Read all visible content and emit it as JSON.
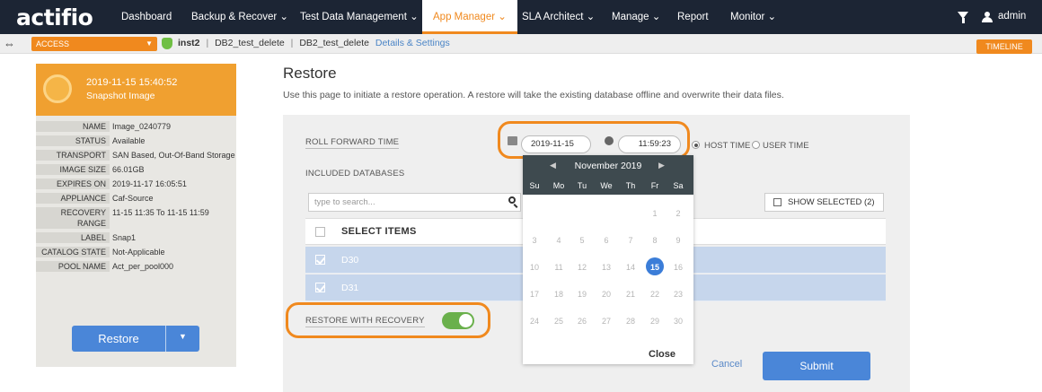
{
  "brand": {
    "logo": "actifio",
    "accent": "#f0891e",
    "nav_bg": "#1c2534"
  },
  "topnav": {
    "items": [
      {
        "label": "Dashboard"
      },
      {
        "label": "Backup & Recover ⌄"
      },
      {
        "label": "Test Data Management ⌄"
      },
      {
        "label": "App Manager ⌄",
        "active": true
      },
      {
        "label": "SLA Architect ⌄"
      },
      {
        "label": "Manage ⌄"
      },
      {
        "label": "Report"
      },
      {
        "label": "Monitor ⌄"
      }
    ],
    "user": "admin",
    "filter_icon": "filter-icon",
    "user_icon": "user-icon"
  },
  "subbar": {
    "access": "ACCESS",
    "instance": "inst2",
    "db1": "DB2_test_delete",
    "db2": "DB2_test_delete",
    "details": "Details & Settings",
    "timeline": "TIMELINE"
  },
  "snapshot": {
    "date": "2019-11-15 15:40:52",
    "type": "Snapshot Image",
    "props": [
      {
        "k": "NAME",
        "v": "Image_0240779"
      },
      {
        "k": "STATUS",
        "v": "Available"
      },
      {
        "k": "TRANSPORT",
        "v": "SAN Based, Out-Of-Band Storage"
      },
      {
        "k": "IMAGE SIZE",
        "v": "66.01GB"
      },
      {
        "k": "EXPIRES ON",
        "v": "2019-11-17 16:05:51"
      },
      {
        "k": "APPLIANCE",
        "v": "Caf-Source"
      },
      {
        "k": "RECOVERY RANGE",
        "v": "11-15 11:35 To 11-15 11:59"
      },
      {
        "k": "LABEL",
        "v": "Snap1"
      },
      {
        "k": "CATALOG STATE",
        "v": "Not-Applicable"
      },
      {
        "k": "POOL NAME",
        "v": "Act_per_pool000"
      }
    ],
    "restore_button": "Restore"
  },
  "restore": {
    "title": "Restore",
    "description": "Use this page to initiate a restore operation. A restore will take the existing database offline and overwrite their data files.",
    "roll_forward_label": "ROLL FORWARD TIME",
    "date_value": "2019-11-15",
    "time_value": "11:59:23",
    "host_time": "HOST TIME",
    "user_time": "USER TIME",
    "included_label": "INCLUDED DATABASES",
    "search_placeholder": "type to search...",
    "show_selected": "SHOW SELECTED (2)",
    "select_items": "SELECT ITEMS",
    "rows": [
      "D30",
      "D31"
    ],
    "restore_with_recovery": "RESTORE WITH RECOVERY",
    "cancel": "Cancel",
    "submit": "Submit"
  },
  "calendar": {
    "month": "November 2019",
    "dows": [
      "Su",
      "Mo",
      "Tu",
      "We",
      "Th",
      "Fr",
      "Sa"
    ],
    "weeks": [
      [
        "",
        "",
        "",
        "",
        "",
        "1",
        "2"
      ],
      [
        "3",
        "4",
        "5",
        "6",
        "7",
        "8",
        "9"
      ],
      [
        "10",
        "11",
        "12",
        "13",
        "14",
        "15",
        "16"
      ],
      [
        "17",
        "18",
        "19",
        "20",
        "21",
        "22",
        "23"
      ],
      [
        "24",
        "25",
        "26",
        "27",
        "28",
        "29",
        "30"
      ]
    ],
    "selected": "15",
    "close": "Close"
  }
}
